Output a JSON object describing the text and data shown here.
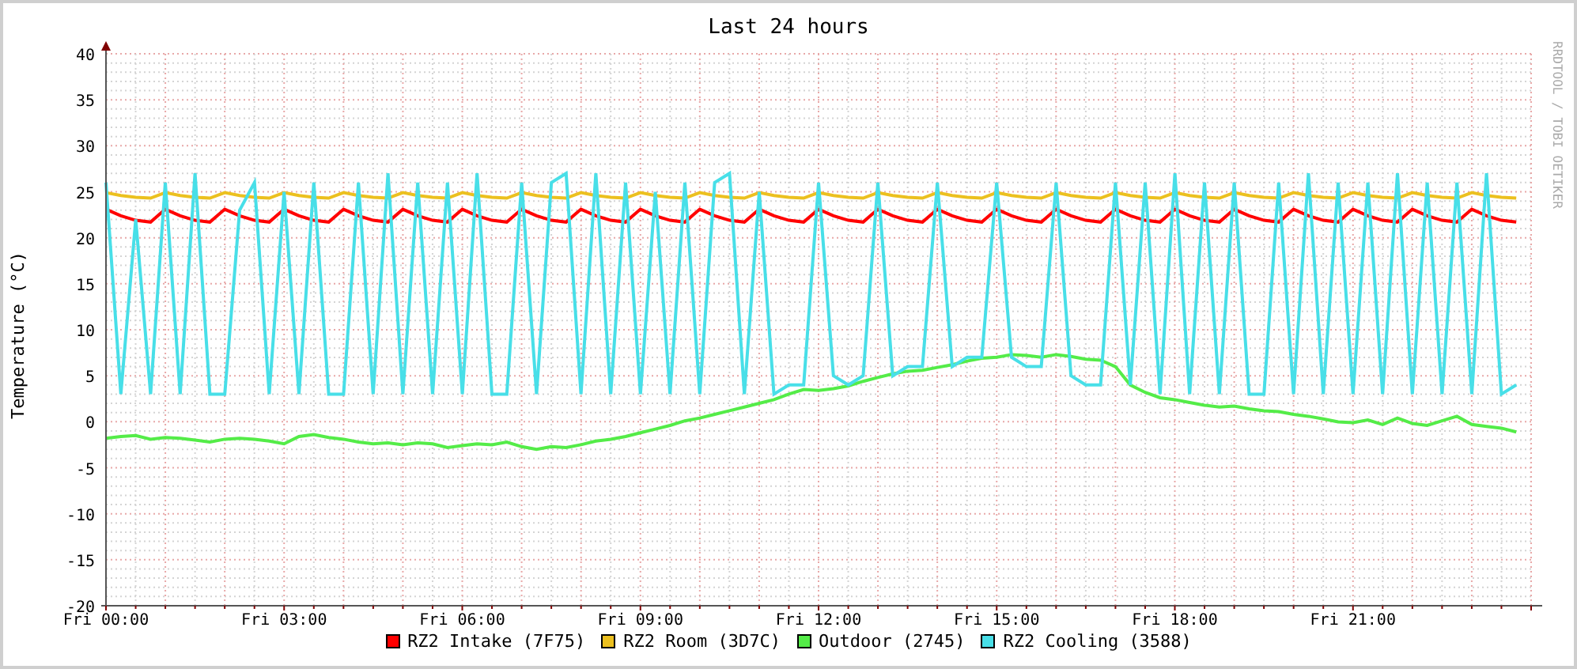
{
  "chart": {
    "credit": "RRDTOOL / TOBI OETIKER",
    "chart_data": {
      "type": "line",
      "title": "Last 24 hours",
      "ylabel": "Temperature (°C)",
      "ylim": [
        -20,
        40
      ],
      "grid": true,
      "yticks": [
        -20,
        -15,
        -10,
        -5,
        0,
        5,
        10,
        15,
        20,
        25,
        30,
        35,
        40
      ],
      "categories": [
        "Fri 00:00",
        null,
        null,
        null,
        null,
        null,
        null,
        null,
        null,
        null,
        null,
        null,
        "Fri 03:00",
        null,
        null,
        null,
        null,
        null,
        null,
        null,
        null,
        null,
        null,
        null,
        "Fri 06:00",
        null,
        null,
        null,
        null,
        null,
        null,
        null,
        null,
        null,
        null,
        null,
        "Fri 09:00",
        null,
        null,
        null,
        null,
        null,
        null,
        null,
        null,
        null,
        null,
        null,
        "Fri 12:00",
        null,
        null,
        null,
        null,
        null,
        null,
        null,
        null,
        null,
        null,
        null,
        "Fri 15:00",
        null,
        null,
        null,
        null,
        null,
        null,
        null,
        null,
        null,
        null,
        null,
        "Fri 18:00",
        null,
        null,
        null,
        null,
        null,
        null,
        null,
        null,
        null,
        null,
        null,
        "Fri 21:00",
        null,
        null,
        null,
        null,
        null,
        null,
        null,
        null,
        null,
        null,
        null
      ],
      "series": [
        {
          "name": "RZ2 Intake (7F75)",
          "color": "#ff0000",
          "values": [
            23.1,
            22.4,
            21.9,
            21.7,
            23.1,
            22.4,
            21.9,
            21.7,
            23.1,
            22.4,
            21.9,
            21.7,
            23.1,
            22.4,
            21.9,
            21.7,
            23.1,
            22.4,
            21.9,
            21.7,
            23.1,
            22.4,
            21.9,
            21.7,
            23.1,
            22.4,
            21.9,
            21.7,
            23.1,
            22.4,
            21.9,
            21.7,
            23.1,
            22.4,
            21.9,
            21.7,
            23.1,
            22.4,
            21.9,
            21.7,
            23.1,
            22.4,
            21.9,
            21.7,
            23.1,
            22.4,
            21.9,
            21.7,
            23.1,
            22.4,
            21.9,
            21.7,
            23.1,
            22.4,
            21.9,
            21.7,
            23.1,
            22.4,
            21.9,
            21.7,
            23.1,
            22.4,
            21.9,
            21.7,
            23.1,
            22.4,
            21.9,
            21.7,
            23.1,
            22.4,
            21.9,
            21.7,
            23.1,
            22.4,
            21.9,
            21.7,
            23.1,
            22.4,
            21.9,
            21.7,
            23.1,
            22.4,
            21.9,
            21.7,
            23.1,
            22.4,
            21.9,
            21.7,
            23.1,
            22.4,
            21.9,
            21.7,
            23.1,
            22.4,
            21.9,
            21.7
          ]
        },
        {
          "name": "RZ2 Room (3D7C)",
          "color": "#ecc01f",
          "values": [
            24.9,
            24.6,
            24.4,
            24.3,
            24.9,
            24.6,
            24.4,
            24.3,
            24.9,
            24.6,
            24.4,
            24.3,
            24.9,
            24.6,
            24.4,
            24.3,
            24.9,
            24.6,
            24.4,
            24.3,
            24.9,
            24.6,
            24.4,
            24.3,
            24.9,
            24.6,
            24.4,
            24.3,
            24.9,
            24.6,
            24.4,
            24.3,
            24.9,
            24.6,
            24.4,
            24.3,
            24.9,
            24.6,
            24.4,
            24.3,
            24.9,
            24.6,
            24.4,
            24.3,
            24.9,
            24.6,
            24.4,
            24.3,
            24.9,
            24.6,
            24.4,
            24.3,
            24.9,
            24.6,
            24.4,
            24.3,
            24.9,
            24.6,
            24.4,
            24.3,
            24.9,
            24.6,
            24.4,
            24.3,
            24.9,
            24.6,
            24.4,
            24.3,
            24.9,
            24.6,
            24.4,
            24.3,
            24.9,
            24.6,
            24.4,
            24.3,
            24.9,
            24.6,
            24.4,
            24.3,
            24.9,
            24.6,
            24.4,
            24.3,
            24.9,
            24.6,
            24.4,
            24.3,
            24.9,
            24.6,
            24.4,
            24.3,
            24.9,
            24.6,
            24.4,
            24.3
          ]
        },
        {
          "name": "Outdoor (2745)",
          "color": "#54ec48",
          "values": [
            -1.8,
            -1.6,
            -1.5,
            -1.9,
            -1.7,
            -1.8,
            -2.0,
            -2.2,
            -1.9,
            -1.8,
            -1.9,
            -2.1,
            -2.4,
            -1.6,
            -1.4,
            -1.7,
            -1.9,
            -2.2,
            -2.4,
            -2.3,
            -2.5,
            -2.3,
            -2.4,
            -2.8,
            -2.6,
            -2.4,
            -2.5,
            -2.2,
            -2.7,
            -3.0,
            -2.7,
            -2.8,
            -2.5,
            -2.1,
            -1.9,
            -1.6,
            -1.2,
            -0.8,
            -0.4,
            0.1,
            0.4,
            0.8,
            1.2,
            1.6,
            2.0,
            2.4,
            3.0,
            3.5,
            3.4,
            3.6,
            3.9,
            4.4,
            4.8,
            5.2,
            5.5,
            5.6,
            5.9,
            6.2,
            6.6,
            6.9,
            7.0,
            7.3,
            7.2,
            7.0,
            7.3,
            7.1,
            6.8,
            6.7,
            6.0,
            4.0,
            3.2,
            2.6,
            2.4,
            2.1,
            1.8,
            1.6,
            1.7,
            1.4,
            1.2,
            1.1,
            0.8,
            0.6,
            0.3,
            0.0,
            -0.1,
            0.2,
            -0.3,
            0.4,
            -0.2,
            -0.4,
            0.1,
            0.6,
            -0.3,
            -0.5,
            -0.7,
            -1.1
          ]
        },
        {
          "name": "RZ2 Cooling (3588)",
          "color": "#48dfe8",
          "values": [
            26,
            3,
            22,
            3,
            26,
            3,
            27,
            3,
            3,
            23,
            26,
            3,
            25,
            3,
            26,
            3,
            3,
            26,
            3,
            27,
            3,
            26,
            3,
            26,
            3,
            27,
            3,
            3,
            26,
            3,
            26,
            27,
            3,
            27,
            3,
            26,
            3,
            25,
            3,
            26,
            3,
            26,
            27,
            3,
            25,
            3,
            4,
            4,
            26,
            5,
            4,
            5,
            26,
            5,
            6,
            6,
            26,
            6,
            7,
            7,
            26,
            7,
            6,
            6,
            26,
            5,
            4,
            4,
            26,
            4,
            26,
            3,
            27,
            3,
            26,
            3,
            26,
            3,
            3,
            26,
            3,
            27,
            3,
            26,
            3,
            26,
            3,
            27,
            3,
            26,
            3,
            26,
            3,
            27,
            3,
            4
          ]
        }
      ]
    }
  }
}
